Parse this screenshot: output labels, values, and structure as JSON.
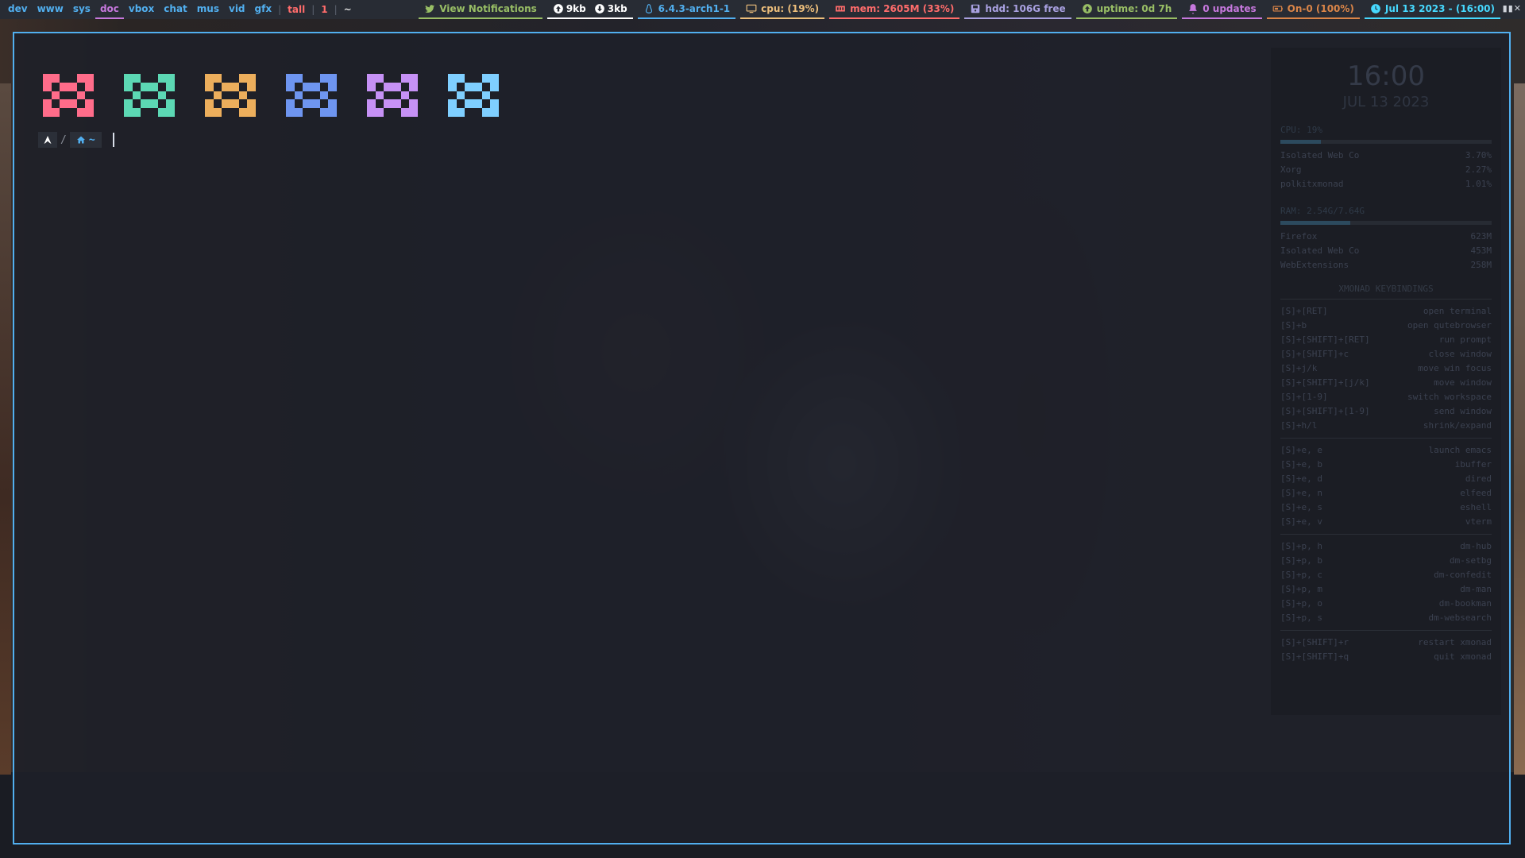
{
  "workspaces": [
    {
      "label": "dev",
      "color": "#51afef"
    },
    {
      "label": "www",
      "color": "#51afef"
    },
    {
      "label": "sys",
      "color": "#51afef"
    },
    {
      "label": "doc",
      "color": "#c678dd",
      "active": true
    },
    {
      "label": "vbox",
      "color": "#51afef"
    },
    {
      "label": "chat",
      "color": "#51afef"
    },
    {
      "label": "mus",
      "color": "#51afef"
    },
    {
      "label": "vid",
      "color": "#51afef"
    },
    {
      "label": "gfx",
      "color": "#51afef"
    }
  ],
  "layout": "tall",
  "window_count": "1",
  "window_title": "~",
  "widgets": {
    "notifications": {
      "label": "View Notifications",
      "color": "#98be65",
      "icon": "twitter-bird-icon"
    },
    "net_up": {
      "label": "9kb",
      "icon": "arrow-up-circle-icon"
    },
    "net_down": {
      "label": "3kb",
      "icon": "arrow-down-circle-icon"
    },
    "kernel": {
      "label": "6.4.3-arch1-1",
      "color": "#51afef",
      "icon": "penguin-icon"
    },
    "cpu": {
      "label": "cpu: (19%)",
      "color": "#ecbe7b",
      "icon": "monitor-icon"
    },
    "mem": {
      "label": "mem: 2605M (33%)",
      "color": "#ff6c6b",
      "icon": "memory-icon"
    },
    "hdd": {
      "label": "hdd: 106G free",
      "color": "#a9a1e1",
      "icon": "disk-icon"
    },
    "uptime": {
      "label": "uptime: 0d 7h",
      "color": "#98be65",
      "icon": "arrow-up-circle-icon"
    },
    "updates": {
      "label": "0 updates",
      "color": "#c678dd",
      "icon": "bell-icon"
    },
    "battery": {
      "label": "On-0 (100%)",
      "color": "#da8548",
      "icon": "battery-icon"
    },
    "clock": {
      "label": "Jul 13 2023 - (16:00)",
      "color": "#46d9ff",
      "icon": "clock-icon"
    }
  },
  "terminal": {
    "palette": [
      "#ff6c8a",
      "#5cd8b4",
      "#ecae5c",
      "#6e95f0",
      "#c691f5",
      "#7fcfff"
    ],
    "prompt": {
      "os_icon": "arch-logo-icon",
      "separator": "/",
      "dir_icon": "home-icon",
      "dir": "~"
    }
  },
  "conky": {
    "time": "16:00",
    "date": "JUL 13 2023",
    "cpu_header": "CPU: 19%",
    "cpu_percent": 19,
    "procs": [
      {
        "name": "Isolated Web Co",
        "val": "3.70%"
      },
      {
        "name": "Xorg",
        "val": "2.27%"
      },
      {
        "name": "polkitxmonad",
        "val": "1.01%"
      }
    ],
    "ram_header": "RAM: 2.54G/7.64G",
    "ram_percent": 33,
    "mems": [
      {
        "name": "Firefox",
        "val": "623M"
      },
      {
        "name": "Isolated Web Co",
        "val": "453M"
      },
      {
        "name": "WebExtensions",
        "val": "258M"
      }
    ],
    "keys_title": "XMONAD KEYBINDINGS",
    "keys": [
      {
        "k": "[S]+[RET]",
        "v": "open terminal"
      },
      {
        "k": "[S]+b",
        "v": "open qutebrowser"
      },
      {
        "k": "[S]+[SHIFT]+[RET]",
        "v": "run prompt"
      },
      {
        "k": "[S]+[SHIFT]+c",
        "v": "close window"
      },
      {
        "k": "[S]+j/k",
        "v": "move win focus"
      },
      {
        "k": "[S]+[SHIFT]+[j/k]",
        "v": "move window"
      },
      {
        "k": "[S]+[1-9]",
        "v": "switch workspace"
      },
      {
        "k": "[S]+[SHIFT]+[1-9]",
        "v": "send window"
      },
      {
        "k": "[S]+h/l",
        "v": "shrink/expand"
      }
    ],
    "keys2": [
      {
        "k": "[S]+e, e",
        "v": "launch emacs"
      },
      {
        "k": "[S]+e, b",
        "v": "ibuffer"
      },
      {
        "k": "[S]+e, d",
        "v": "dired"
      },
      {
        "k": "[S]+e, n",
        "v": "elfeed"
      },
      {
        "k": "[S]+e, s",
        "v": "eshell"
      },
      {
        "k": "[S]+e, v",
        "v": "vterm"
      }
    ],
    "keys3": [
      {
        "k": "[S]+p, h",
        "v": "dm-hub"
      },
      {
        "k": "[S]+p, b",
        "v": "dm-setbg"
      },
      {
        "k": "[S]+p, c",
        "v": "dm-confedit"
      },
      {
        "k": "[S]+p, m",
        "v": "dm-man"
      },
      {
        "k": "[S]+p, o",
        "v": "dm-bookman"
      },
      {
        "k": "[S]+p, s",
        "v": "dm-websearch"
      }
    ],
    "keys4": [
      {
        "k": "[S]+[SHIFT]+r",
        "v": "restart xmonad"
      },
      {
        "k": "[S]+[SHIFT]+q",
        "v": "quit xmonad"
      }
    ]
  }
}
